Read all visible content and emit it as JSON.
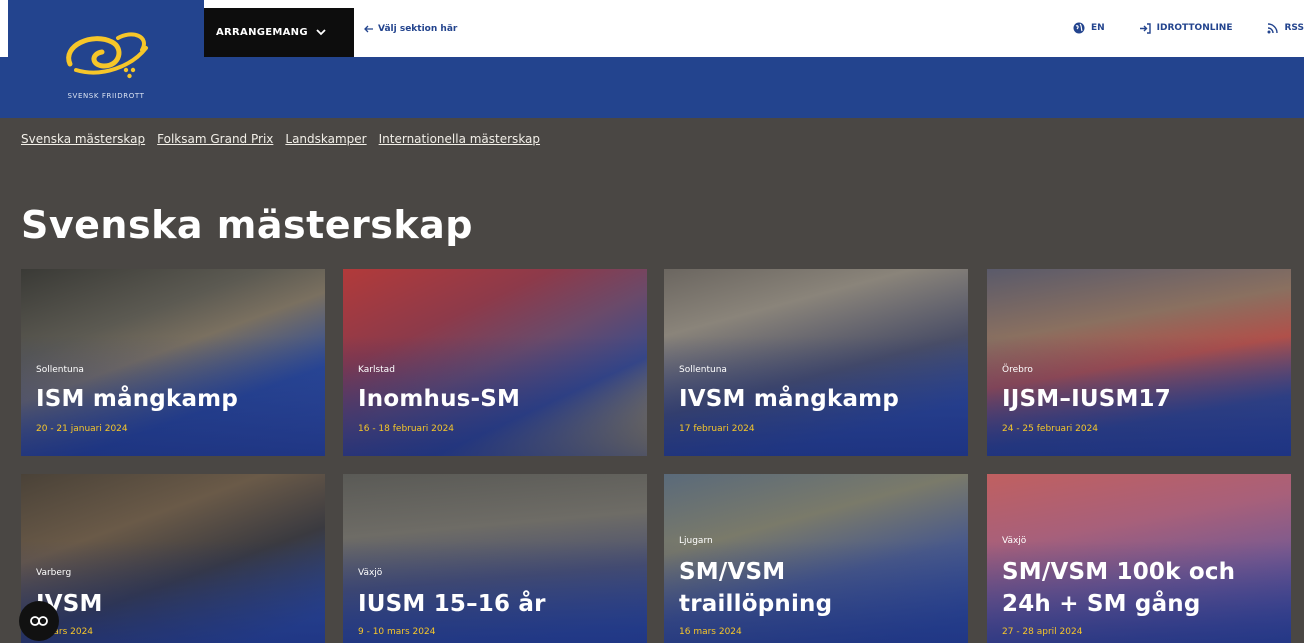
{
  "header": {
    "logo_text": "SVENSK FRIIDROTT",
    "menu_label": "ARRANGEMANG",
    "section_hint": "Välj sektion här",
    "lang_label": "EN",
    "login_label": "IDROTTONLINE",
    "rss_label": "RSS"
  },
  "subnav": [
    "Svenska mästerskap",
    "Folksam Grand Prix",
    "Landskamper",
    "Internationella mästerskap"
  ],
  "page_title": "Svenska mästerskap",
  "cards": [
    {
      "location": "Sollentuna",
      "title": "ISM mångkamp",
      "date": "20 - 21 januari 2024"
    },
    {
      "location": "Karlstad",
      "title": "Inomhus-SM",
      "date": "16 - 18 februari 2024"
    },
    {
      "location": "Sollentuna",
      "title": "IVSM mångkamp",
      "date": "17 februari 2024"
    },
    {
      "location": "Örebro",
      "title": "IJSM–IUSM17",
      "date": "24 - 25 februari 2024"
    },
    {
      "location": "Varberg",
      "title": "IVSM",
      "date": "3 mars 2024"
    },
    {
      "location": "Växjö",
      "title": "IUSM 15–16 år",
      "date": "9 - 10 mars 2024"
    },
    {
      "location": "Ljugarn",
      "title_line1": "SM/VSM",
      "title_line2": "traillöpning",
      "date": "16 mars 2024"
    },
    {
      "location": "Växjö",
      "title_line1": "SM/VSM 100k och",
      "title_line2": "24h + SM gång",
      "date": "27 - 28 april 2024"
    }
  ],
  "colors": {
    "brand_blue": "#23448e",
    "accent_yellow": "#f6c629",
    "page_bg": "#4a4744"
  },
  "icons": [
    "chevron-down-icon",
    "arrow-left-icon",
    "globe-icon",
    "login-icon",
    "rss-icon",
    "cookie-icon"
  ]
}
